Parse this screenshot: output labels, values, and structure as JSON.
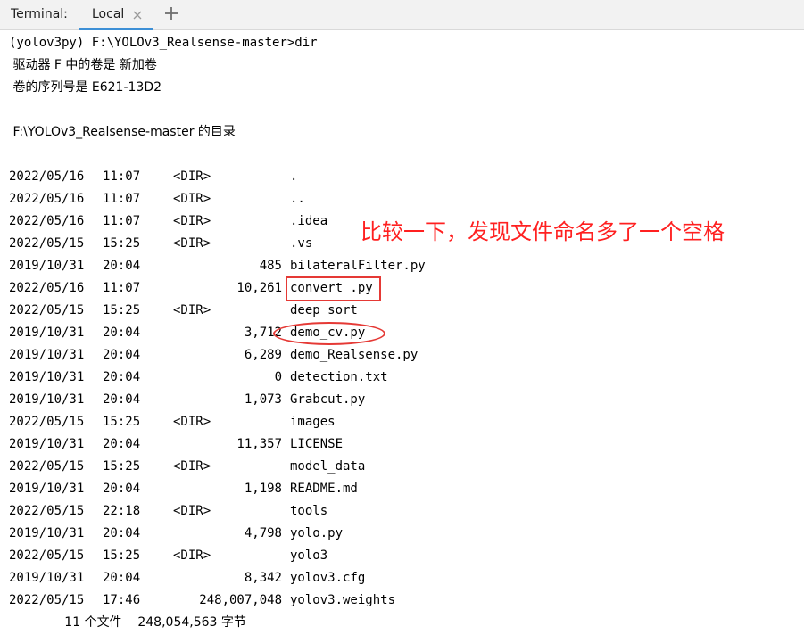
{
  "tabbar": {
    "title": "Terminal:",
    "tabs": [
      {
        "label": "Local",
        "active": true
      }
    ],
    "accent_color": "#3d8fd6",
    "add_icon": "plus-icon",
    "close_icon": "close-icon"
  },
  "terminal": {
    "prompt_line": "(yolov3py) F:\\YOLOv3_Realsense-master>dir",
    "volume_line": " 驱动器 F 中的卷是 新加卷",
    "serial_line": " 卷的序列号是 E621-13D2",
    "dir_header": " F:\\YOLOv3_Realsense-master 的目录",
    "entries": [
      {
        "date": "2022/05/16",
        "time": "11:07",
        "type": "<DIR>",
        "size": "",
        "name": "."
      },
      {
        "date": "2022/05/16",
        "time": "11:07",
        "type": "<DIR>",
        "size": "",
        "name": ".."
      },
      {
        "date": "2022/05/16",
        "time": "11:07",
        "type": "<DIR>",
        "size": "",
        "name": ".idea"
      },
      {
        "date": "2022/05/15",
        "time": "15:25",
        "type": "<DIR>",
        "size": "",
        "name": ".vs"
      },
      {
        "date": "2019/10/31",
        "time": "20:04",
        "type": "",
        "size": "485",
        "name": "bilateralFilter.py"
      },
      {
        "date": "2022/05/16",
        "time": "11:07",
        "type": "",
        "size": "10,261",
        "name": "convert .py"
      },
      {
        "date": "2022/05/15",
        "time": "15:25",
        "type": "<DIR>",
        "size": "",
        "name": "deep_sort"
      },
      {
        "date": "2019/10/31",
        "time": "20:04",
        "type": "",
        "size": "3,712",
        "name": "demo_cv.py"
      },
      {
        "date": "2019/10/31",
        "time": "20:04",
        "type": "",
        "size": "6,289",
        "name": "demo_Realsense.py"
      },
      {
        "date": "2019/10/31",
        "time": "20:04",
        "type": "",
        "size": "0",
        "name": "detection.txt"
      },
      {
        "date": "2019/10/31",
        "time": "20:04",
        "type": "",
        "size": "1,073",
        "name": "Grabcut.py"
      },
      {
        "date": "2022/05/15",
        "time": "15:25",
        "type": "<DIR>",
        "size": "",
        "name": "images"
      },
      {
        "date": "2019/10/31",
        "time": "20:04",
        "type": "",
        "size": "11,357",
        "name": "LICENSE"
      },
      {
        "date": "2022/05/15",
        "time": "15:25",
        "type": "<DIR>",
        "size": "",
        "name": "model_data"
      },
      {
        "date": "2019/10/31",
        "time": "20:04",
        "type": "",
        "size": "1,198",
        "name": "README.md"
      },
      {
        "date": "2022/05/15",
        "time": "22:18",
        "type": "<DIR>",
        "size": "",
        "name": "tools"
      },
      {
        "date": "2019/10/31",
        "time": "20:04",
        "type": "",
        "size": "4,798",
        "name": "yolo.py"
      },
      {
        "date": "2022/05/15",
        "time": "15:25",
        "type": "<DIR>",
        "size": "",
        "name": "yolo3"
      },
      {
        "date": "2019/10/31",
        "time": "20:04",
        "type": "",
        "size": "8,342",
        "name": "yolov3.cfg"
      },
      {
        "date": "2022/05/15",
        "time": "17:46",
        "type": "",
        "size": "248,007,048",
        "name": "yolov3.weights"
      }
    ],
    "summary_line": "              11 个文件    248,054,563 字节"
  },
  "annotation": {
    "text": "比较一下，发现文件命名多了一个空格",
    "color": "#ff2020"
  }
}
